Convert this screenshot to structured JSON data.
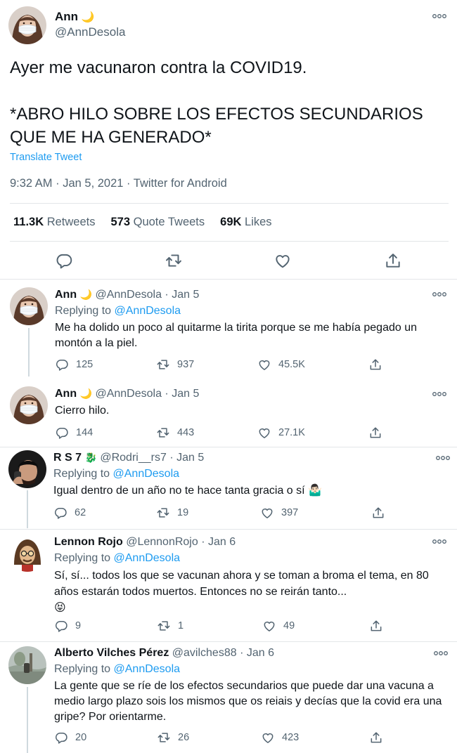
{
  "main_tweet": {
    "name": "Ann",
    "name_emoji": "🌙",
    "handle": "@AnnDesola",
    "text": "Ayer me vacunaron contra la COVID19.\n\n*ABRO HILO SOBRE LOS EFECTOS SECUNDARIOS QUE ME HA GENERADO*",
    "translate_label": "Translate Tweet",
    "meta": "9:32 AM · Jan 5, 2021 · Twitter for Android",
    "stats": {
      "retweets_count": "11.3K",
      "retweets_label": "Retweets",
      "quotes_count": "573",
      "quotes_label": "Quote Tweets",
      "likes_count": "69K",
      "likes_label": "Likes"
    },
    "icons": [
      "reply-icon",
      "retweet-icon",
      "like-icon",
      "share-icon"
    ]
  },
  "replies": [
    {
      "name": "Ann",
      "name_emoji": "🌙",
      "handle": "@AnnDesola",
      "date": "· Jan 5",
      "replying_label": "Replying to",
      "replying_to": "@AnnDesola",
      "text": "Me ha dolido un poco al quitarme la tirita porque se me había pegado un montón a la piel.",
      "replies": "125",
      "retweets": "937",
      "likes": "45.5K"
    },
    {
      "name": "Ann",
      "name_emoji": "🌙",
      "handle": "@AnnDesola",
      "date": "· Jan 5",
      "text": "Cierro hilo.",
      "replies": "144",
      "retweets": "443",
      "likes": "27.1K"
    },
    {
      "name": "R S 7",
      "name_emoji": "🐉",
      "handle": "@Rodri__rs7",
      "date": "· Jan 5",
      "replying_label": "Replying to",
      "replying_to": "@AnnDesola",
      "text": "Igual dentro de un año no te hace tanta gracia o sí 🤷🏻‍♂️",
      "replies": "62",
      "retweets": "19",
      "likes": "397"
    },
    {
      "name": "Lennon Rojo",
      "handle": "@LennonRojo",
      "date": "· Jan 6",
      "replying_label": "Replying to",
      "replying_to": "@AnnDesola",
      "text": "Sí, sí... todos los que se vacunan ahora y se toman a broma el tema, en 80 años estarán todos muertos. Entonces no se reirán tanto...\n😝",
      "replies": "9",
      "retweets": "1",
      "likes": "49"
    },
    {
      "name": "Alberto Vilches Pérez",
      "handle": "@avilches88",
      "date": "· Jan 6",
      "replying_label": "Replying to",
      "replying_to": "@AnnDesola",
      "text": "La gente que se ríe de los efectos secundarios que puede dar una vacuna a medio largo plazo sois los mismos que os reiais y decías que la covid era una gripe? Por orientarme.",
      "replies": "20",
      "retweets": "26",
      "likes": "423"
    }
  ],
  "colors": {
    "link": "#1d9bf0",
    "secondary_text": "#536471",
    "text": "#0f1419",
    "divider": "#e3e6e8",
    "thread_line": "#cfd9de"
  }
}
